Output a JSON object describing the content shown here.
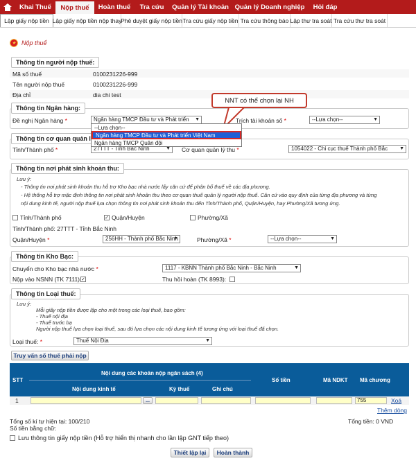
{
  "nav": {
    "items": [
      "Khai Thuế",
      "Nộp thuế",
      "Hoàn thuế",
      "Tra cứu",
      "Quản lý Tài khoản",
      "Quản lý Doanh nghiệp",
      "Hỏi đáp"
    ]
  },
  "subtabs": [
    "Lập giấy nộp tiền",
    "Lập giấy nộp tiền nộp thay",
    "Phê duyệt giấy nộp tiền",
    "Tra cứu giấy nộp tiền",
    "Tra cứu thông báo",
    "Lập thư tra soát",
    "Tra cứu thư tra soát"
  ],
  "page_title": "Nộp thuế",
  "taxpayer": {
    "title": "Thông tin người nộp thuế:",
    "mst_label": "Mã số thuế",
    "mst_value": "0100231226-999",
    "name_label": "Tên người nộp thuế",
    "name_value": "0100231226-999",
    "addr_label": "Địa chỉ",
    "addr_value": "dia chi test"
  },
  "bank": {
    "title": "Thông tin Ngân hàng:",
    "bank_label": "Đề nghị Ngân hàng",
    "bank_value": "Ngân hàng TMCP Đầu tư và Phát triển",
    "account_label": "Trích tài khoản số",
    "account_value": "--Lựa chọn--",
    "dropdown_options": [
      "--Lựa chọn--",
      "Ngân hàng TMCP Đầu tư và Phát triển Việt Nam",
      "Ngân hàng TMCP Quân đội"
    ],
    "callout": "NNT có thể chọn lại NH"
  },
  "agency": {
    "title": "Thông tin cơ quan quản lý thu:",
    "province_label": "Tỉnh/Thành phố",
    "province_value": "27TTT - Tỉnh Bắc Ninh",
    "agency_label": "Cơ quan quản lý thu",
    "agency_value": "1054022 - Chi cục thuế Thành phố Bắc"
  },
  "origin": {
    "title": "Thông tin nơi phát sinh khoản thu:",
    "note_title": "Lưu ý:",
    "note1": "- Thông tin nơi phát sinh khoản thu hỗ trợ Kho bạc nhà nước lấy căn cứ để phân bổ thuế về các địa phương.",
    "note2": "- Hệ thống hỗ trợ mặc định thông tin nơi phát sinh khoản thu theo cơ quan thuế quản lý người nộp thuế. Căn cứ vào quy định của từng địa phương và từng",
    "note3": "nội dung kinh tế, người nộp thuế lựa chọn thông tin nơi phát sinh khoản thu đến Tỉnh/Thành phố, Quận/Huyện, hay Phường/Xã tương ứng.",
    "opt_province": "Tỉnh/Thành phố",
    "opt_district": "Quận/Huyện",
    "opt_ward": "Phường/Xã",
    "province_line": "Tỉnh/Thành phố: 27TTT - Tỉnh Bắc Ninh",
    "district_label": "Quận/Huyện",
    "district_value": "256HH - Thành phố Bắc Ninh",
    "ward_label": "Phường/Xã",
    "ward_value": "--Lựa chọn--"
  },
  "treasury": {
    "title": "Thông tin Kho Bạc:",
    "transfer_label": "Chuyển cho Kho bạc nhà nước",
    "transfer_value": "1117 - KBNN Thành phố Bắc Ninh - Bắc Ninh",
    "nsnn_label": "Nộp vào NSNN (TK 7111):",
    "refund_label": "Thu hồi hoàn (TK 8993):"
  },
  "taxtype": {
    "title": "Thông tin Loại thuế:",
    "note_title": "Lưu ý:",
    "note1": "Mỗi giấy nộp tiền được lập cho một trong các loại thuế, bao gồm:",
    "note2": "- Thuế nội địa",
    "note3": "- Thuế trước bạ",
    "note4": "Người nộp thuế lựa chọn loại thuế, sau đó lựa chọn các nội dung kinh tế tương ứng với loại thuế đã chọn.",
    "type_label": "Loại thuế:",
    "type_value": "Thuế Nội Địa"
  },
  "lookup_button": "Truy vấn số thuế phải nộp",
  "table": {
    "stt": "STT",
    "group": "Nội dung các khoản nộp ngân sách (4)",
    "content": "Nội dung kinh tế",
    "period": "Kỳ thuế",
    "memo": "Ghi chú",
    "amount": "Số tiền",
    "ndkt": "Mã NDKT",
    "chapter": "Mã chương",
    "row_stt": "1",
    "row_chapter": "755",
    "delete": "Xoá",
    "browse": "..."
  },
  "add_row": "Thêm dòng",
  "summary": {
    "chars": "Tổng số kí tự hiện tại: 100/210",
    "words": "Số tiền bằng chữ:",
    "total": "Tổng tiền: 0 VND"
  },
  "save_info": "Lưu thông tin giấy nộp tiền (Hỗ trợ hiển thị nhanh cho lần lập GNT tiếp theo)",
  "buttons": {
    "reset": "Thiết lập lại",
    "done": "Hoàn thành"
  }
}
